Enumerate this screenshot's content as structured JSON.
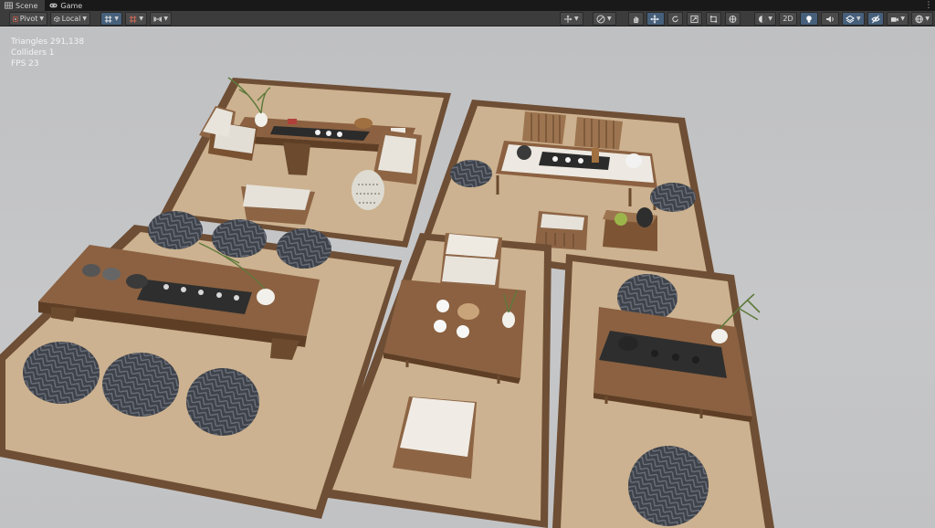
{
  "tabs": [
    {
      "label": "Scene",
      "icon": "scene-grid-icon",
      "active": true
    },
    {
      "label": "Game",
      "icon": "gamepad-icon",
      "active": false
    }
  ],
  "toolbar": {
    "pivot_label": "Pivot",
    "local_label": "Local",
    "mode_2d_label": "2D"
  },
  "stats": {
    "triangles": "Triangles 291,138",
    "colliders": "Colliders 1",
    "fps": "FPS 23"
  },
  "colors": {
    "tabbar_bg": "#191919",
    "toolbar_bg": "#3c3c3c",
    "active_tool": "#46607c",
    "viewport_bg": "#c4c5c7",
    "mat_border": "#6e4e34",
    "mat_fill": "#cdb391",
    "wood": "#7d5535",
    "cushion": "#e4e0d8",
    "rug": "#3c4048"
  }
}
